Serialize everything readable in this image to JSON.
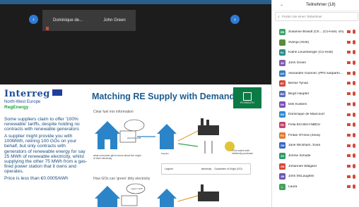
{
  "video": {
    "tiles": [
      {
        "name": "Dominique de..."
      },
      {
        "name": "John Green"
      }
    ],
    "prev_icon": "chevron-left-icon",
    "next_icon": "chevron-right-icon"
  },
  "slide": {
    "brand": {
      "name": "Interreg",
      "region": "North-West Europe",
      "program": "RegEnergy"
    },
    "title": "Matching RE Supply with Demand",
    "partner_logo": "PLYMOUTH",
    "paragraphs": [
      "Some suppliers claim to offer '100% renewable' tariffs, despite holding no contracts with renewable generators",
      "A supplier might provide you with 100MWh, retiring 100 GOs on your behalf, but only contracts with generators of renewable energy for say 25 MWh of renewable electricity, whilst supplying the other 75 MWh from a gas-fired power station that it owns and operates.",
      "Price is less than €0.0005/kWh"
    ],
    "section1": "Clear fuel mix information",
    "section2": "How GOs can 'green' dirty electricity",
    "labels": {
      "supplier": "Supplier",
      "go_match": "GOs match with electricity purchase",
      "what_consumer": "what consumer get to know about the origin of their electricity",
      "electricity_tariff": "electricity tariff",
      "legend": "Legend",
      "electricity": "electricity",
      "go_label": "Guarantee of Origin (GO)",
      "green_tariff": "\"green\" tariff"
    }
  },
  "panel": {
    "title": "Teilnehmer (18)",
    "search_placeholder": "Finden Sie einen Teilnehmer",
    "participants": [
      {
        "initials": "SB",
        "name": "Susanne Brandt (Ch... (Co-Host, ich)",
        "color": "#3aa36b"
      },
      {
        "initials": "",
        "name": "Svenja (Host)",
        "color": "#5b8c3a"
      },
      {
        "initials": "KL",
        "name": "Katrin Leuenberger (Co-Host)",
        "color": "#2a8c8c"
      },
      {
        "initials": "JG",
        "name": "John Green",
        "color": "#7c5fb0"
      },
      {
        "initials": "AG",
        "name": "Alexandre Guirinec (PP2 subpartn...",
        "color": "#3b7bc2"
      },
      {
        "initials": "BT",
        "name": "Bernie Tynan",
        "color": "#d04b3b"
      },
      {
        "initials": "BH",
        "name": "Birgit Haupter",
        "color": "#5a6ec0"
      },
      {
        "initials": "DK",
        "name": "Dirk Kosters",
        "color": "#7a4fb5"
      },
      {
        "initials": "DD",
        "name": "Dominique de Mancourt",
        "color": "#2c88d1"
      },
      {
        "initials": "FE",
        "name": "Fella ECHIKH-NBDU",
        "color": "#c44570"
      },
      {
        "initials": "FO",
        "name": "Fintan O'Hora (Svea)",
        "color": "#e07b2e"
      },
      {
        "initials": "JW",
        "name": "Jane Wickham, Svea",
        "color": "#3a66c5"
      },
      {
        "initials": "JS",
        "name": "Jimme Schulte",
        "color": "#2e9a6a"
      },
      {
        "initials": "JW",
        "name": "Johannes Walgard",
        "color": "#d1493a"
      },
      {
        "initials": "JM",
        "name": "John McLaughlin",
        "color": "#6d55b4"
      },
      {
        "initials": "L",
        "name": "Laura",
        "color": "#3fa35a"
      }
    ]
  }
}
